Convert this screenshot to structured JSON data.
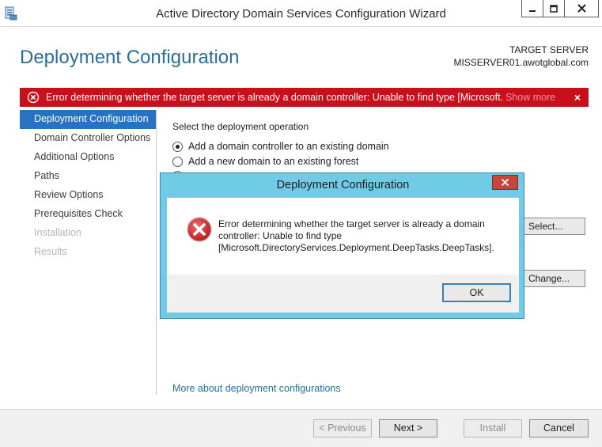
{
  "window": {
    "title": "Active Directory Domain Services Configuration Wizard",
    "minimize_icon": "minimize-icon",
    "maximize_icon": "maximize-icon",
    "close_icon": "close-icon"
  },
  "header": {
    "page_title": "Deployment Configuration",
    "target_label": "TARGET SERVER",
    "target_name": "MISSERVER01.awotglobal.com"
  },
  "error_bar": {
    "message": "Error determining whether the target server is already a domain controller: Unable to find type [Microsoft.Di...",
    "show_more": "Show more",
    "close": "×",
    "color": "#c8101c"
  },
  "nav": {
    "items": [
      {
        "label": "Deployment Configuration",
        "state": "active"
      },
      {
        "label": "Domain Controller Options",
        "state": "normal"
      },
      {
        "label": "Additional Options",
        "state": "normal"
      },
      {
        "label": "Paths",
        "state": "normal"
      },
      {
        "label": "Review Options",
        "state": "normal"
      },
      {
        "label": "Prerequisites Check",
        "state": "normal"
      },
      {
        "label": "Installation",
        "state": "disabled"
      },
      {
        "label": "Results",
        "state": "disabled"
      }
    ]
  },
  "main": {
    "section_label": "Select the deployment operation",
    "options": [
      {
        "label": "Add a domain controller to an existing domain",
        "checked": true
      },
      {
        "label": "Add a new domain to an existing forest",
        "checked": false
      }
    ],
    "select_button": "Select...",
    "change_button": "Change...",
    "more_link": "More about deployment configurations"
  },
  "footer": {
    "previous": "< Previous",
    "next": "Next >",
    "install": "Install",
    "cancel": "Cancel"
  },
  "dialog": {
    "title": "Deployment Configuration",
    "message_line1": "Error determining whether the target server is already a domain",
    "message_line2": "controller: Unable to find type",
    "message_line3": "[Microsoft.DirectoryServices.Deployment.DeepTasks.DeepTasks].",
    "ok": "OK",
    "accent_color": "#6fcbe6"
  }
}
